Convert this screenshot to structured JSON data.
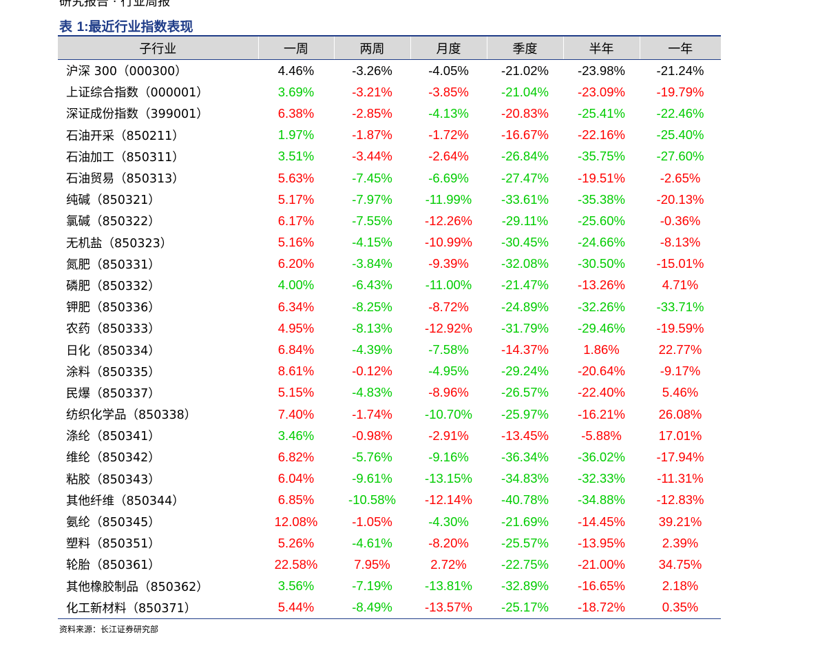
{
  "top_cutoff_text": "研究报告 · 行业周报",
  "table_title_prefix": "表 ",
  "table_title_num": "1:",
  "table_title_text": "最近行业指数表现",
  "headers": [
    "子行业",
    "一周",
    "两周",
    "月度",
    "季度",
    "半年",
    "一年"
  ],
  "colors": {
    "up": "#ff0000",
    "down": "#00cc00",
    "neutral": "#000000",
    "title": "#1f3c88"
  },
  "rows": [
    {
      "name": "沪深 300（000300）",
      "values": [
        "4.46%",
        "-3.26%",
        "-4.05%",
        "-21.02%",
        "-23.98%",
        "-21.24%"
      ],
      "colors": [
        "k",
        "k",
        "k",
        "k",
        "k",
        "k"
      ]
    },
    {
      "name": "上证综合指数（000001）",
      "values": [
        "3.69%",
        "-3.21%",
        "-3.85%",
        "-21.04%",
        "-23.09%",
        "-19.79%"
      ],
      "colors": [
        "g",
        "r",
        "r",
        "g",
        "r",
        "r"
      ]
    },
    {
      "name": "深证成份指数（399001）",
      "values": [
        "6.38%",
        "-2.85%",
        "-4.13%",
        "-20.83%",
        "-25.41%",
        "-22.46%"
      ],
      "colors": [
        "r",
        "r",
        "g",
        "r",
        "g",
        "g"
      ]
    },
    {
      "name": "石油开采（850211）",
      "values": [
        "1.97%",
        "-1.87%",
        "-1.72%",
        "-16.67%",
        "-22.16%",
        "-25.40%"
      ],
      "colors": [
        "g",
        "r",
        "r",
        "r",
        "r",
        "g"
      ]
    },
    {
      "name": "石油加工（850311）",
      "values": [
        "3.51%",
        "-3.44%",
        "-2.64%",
        "-26.84%",
        "-35.75%",
        "-27.60%"
      ],
      "colors": [
        "g",
        "r",
        "r",
        "g",
        "g",
        "g"
      ]
    },
    {
      "name": "石油贸易（850313）",
      "values": [
        "5.63%",
        "-7.45%",
        "-6.69%",
        "-27.47%",
        "-19.51%",
        "-2.65%"
      ],
      "colors": [
        "r",
        "g",
        "g",
        "g",
        "r",
        "r"
      ]
    },
    {
      "name": "纯碱（850321）",
      "values": [
        "5.17%",
        "-7.97%",
        "-11.99%",
        "-33.61%",
        "-35.38%",
        "-20.13%"
      ],
      "colors": [
        "r",
        "g",
        "g",
        "g",
        "g",
        "r"
      ]
    },
    {
      "name": "氯碱（850322）",
      "values": [
        "6.17%",
        "-7.55%",
        "-12.26%",
        "-29.11%",
        "-25.60%",
        "-0.36%"
      ],
      "colors": [
        "r",
        "g",
        "r",
        "g",
        "g",
        "r"
      ]
    },
    {
      "name": "无机盐（850323）",
      "values": [
        "5.16%",
        "-4.15%",
        "-10.99%",
        "-30.45%",
        "-24.66%",
        "-8.13%"
      ],
      "colors": [
        "r",
        "g",
        "r",
        "g",
        "g",
        "r"
      ]
    },
    {
      "name": "氮肥（850331）",
      "values": [
        "6.20%",
        "-3.84%",
        "-9.39%",
        "-32.08%",
        "-30.50%",
        "-15.01%"
      ],
      "colors": [
        "r",
        "g",
        "r",
        "g",
        "g",
        "r"
      ]
    },
    {
      "name": "磷肥（850332）",
      "values": [
        "4.00%",
        "-6.43%",
        "-11.00%",
        "-21.47%",
        "-13.26%",
        "4.71%"
      ],
      "colors": [
        "g",
        "g",
        "g",
        "g",
        "r",
        "r"
      ]
    },
    {
      "name": "钾肥（850336）",
      "values": [
        "6.34%",
        "-8.25%",
        "-8.72%",
        "-24.89%",
        "-32.26%",
        "-33.71%"
      ],
      "colors": [
        "r",
        "g",
        "r",
        "g",
        "g",
        "g"
      ]
    },
    {
      "name": "农药（850333）",
      "values": [
        "4.95%",
        "-8.13%",
        "-12.92%",
        "-31.79%",
        "-29.46%",
        "-19.59%"
      ],
      "colors": [
        "r",
        "g",
        "r",
        "g",
        "g",
        "r"
      ]
    },
    {
      "name": "日化（850334）",
      "values": [
        "6.84%",
        "-4.39%",
        "-7.58%",
        "-14.37%",
        "1.86%",
        "22.77%"
      ],
      "colors": [
        "r",
        "g",
        "g",
        "r",
        "r",
        "r"
      ]
    },
    {
      "name": "涂料（850335）",
      "values": [
        "8.61%",
        "-0.12%",
        "-4.95%",
        "-29.24%",
        "-20.64%",
        "-9.17%"
      ],
      "colors": [
        "r",
        "r",
        "g",
        "g",
        "r",
        "r"
      ]
    },
    {
      "name": "民爆（850337）",
      "values": [
        "5.15%",
        "-4.83%",
        "-8.96%",
        "-26.57%",
        "-22.40%",
        "5.46%"
      ],
      "colors": [
        "r",
        "g",
        "r",
        "g",
        "r",
        "r"
      ]
    },
    {
      "name": "纺织化学品（850338）",
      "values": [
        "7.40%",
        "-1.74%",
        "-10.70%",
        "-25.97%",
        "-16.21%",
        "26.08%"
      ],
      "colors": [
        "r",
        "r",
        "g",
        "g",
        "r",
        "r"
      ]
    },
    {
      "name": "涤纶（850341）",
      "values": [
        "3.46%",
        "-0.98%",
        "-2.91%",
        "-13.45%",
        "-5.88%",
        "17.01%"
      ],
      "colors": [
        "g",
        "r",
        "r",
        "r",
        "r",
        "r"
      ]
    },
    {
      "name": "维纶（850342）",
      "values": [
        "6.82%",
        "-5.76%",
        "-9.16%",
        "-36.34%",
        "-36.02%",
        "-17.94%"
      ],
      "colors": [
        "r",
        "g",
        "g",
        "g",
        "g",
        "r"
      ]
    },
    {
      "name": "粘胶（850343）",
      "values": [
        "6.04%",
        "-9.61%",
        "-13.15%",
        "-34.83%",
        "-32.33%",
        "-11.31%"
      ],
      "colors": [
        "r",
        "g",
        "g",
        "g",
        "g",
        "r"
      ]
    },
    {
      "name": "其他纤维（850344）",
      "values": [
        "6.85%",
        "-10.58%",
        "-12.14%",
        "-40.78%",
        "-34.88%",
        "-12.83%"
      ],
      "colors": [
        "r",
        "g",
        "r",
        "g",
        "g",
        "r"
      ]
    },
    {
      "name": "氨纶（850345）",
      "values": [
        "12.08%",
        "-1.05%",
        "-4.30%",
        "-21.69%",
        "-14.45%",
        "39.21%"
      ],
      "colors": [
        "r",
        "r",
        "g",
        "g",
        "r",
        "r"
      ]
    },
    {
      "name": "塑料（850351）",
      "values": [
        "5.26%",
        "-4.61%",
        "-8.20%",
        "-25.57%",
        "-13.95%",
        "2.39%"
      ],
      "colors": [
        "r",
        "g",
        "r",
        "g",
        "r",
        "r"
      ]
    },
    {
      "name": "轮胎（850361）",
      "values": [
        "22.58%",
        "7.95%",
        "2.72%",
        "-22.75%",
        "-21.00%",
        "34.75%"
      ],
      "colors": [
        "r",
        "r",
        "r",
        "g",
        "r",
        "r"
      ]
    },
    {
      "name": "其他橡胶制品（850362）",
      "values": [
        "3.56%",
        "-7.19%",
        "-13.81%",
        "-32.89%",
        "-16.65%",
        "2.18%"
      ],
      "colors": [
        "g",
        "g",
        "g",
        "g",
        "r",
        "r"
      ]
    },
    {
      "name": "化工新材料（850371）",
      "values": [
        "5.44%",
        "-8.49%",
        "-13.57%",
        "-25.17%",
        "-18.72%",
        "0.35%"
      ],
      "colors": [
        "r",
        "g",
        "r",
        "g",
        "r",
        "r"
      ]
    }
  ],
  "source": "资料来源：长江证券研究部"
}
